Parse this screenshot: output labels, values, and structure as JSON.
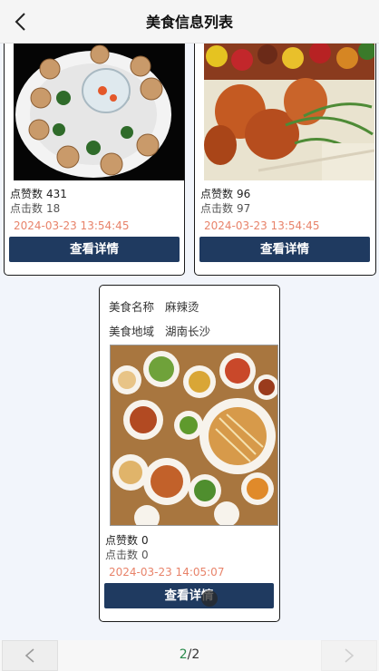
{
  "header": {
    "title": "美食信息列表",
    "back_icon": "chevron-left-icon"
  },
  "cards": [
    {
      "image": "seafood-shrimp-platter",
      "likes_label": "点赞数",
      "likes": "431",
      "clicks_label": "点击数",
      "clicks": "18",
      "time": "2024-03-23 13:54:45",
      "button": "查看详情"
    },
    {
      "image": "grilled-chicken-skewers",
      "likes_label": "点赞数",
      "likes": "96",
      "clicks_label": "点击数",
      "clicks": "97",
      "time": "2024-03-23 13:54:45",
      "button": "查看详情"
    },
    {
      "name_label": "美食名称",
      "name": "麻辣烫",
      "region_label": "美食地域",
      "region": "湖南长沙",
      "image": "spicy-dishes-spread",
      "likes_label": "点赞数",
      "likes": "0",
      "clicks_label": "点击数",
      "clicks": "0",
      "time": "2024-03-23 14:05:07",
      "button": "查看详情"
    }
  ],
  "pager": {
    "current": "2",
    "separator": "/",
    "total": "2",
    "prev_icon": "chevron-left-icon",
    "next_icon": "chevron-right-icon"
  },
  "colors": {
    "button": "#1f3a60",
    "time": "#e8836a",
    "page_current": "#2a8b4c",
    "background": "#f2f5fb"
  }
}
